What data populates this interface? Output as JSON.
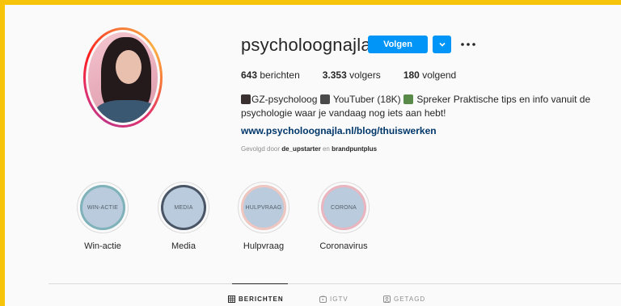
{
  "profile": {
    "username": "psycholoognajla",
    "follow_label": "Volgen"
  },
  "stats": {
    "posts_count": "643",
    "posts_label": "berichten",
    "followers_count": "3.353",
    "followers_label": "volgers",
    "following_count": "180",
    "following_label": "volgend"
  },
  "bio": {
    "line1_part1": "GZ-psycholoog",
    "line1_part2": "YouTuber (18K)",
    "line1_part3": "Spreker Praktische tips en info vanuit de",
    "line2": "psychologie waar je vandaag nog iets aan hebt!",
    "link": "www.psycholoognajla.nl/blog/thuiswerken"
  },
  "followed_by": {
    "prefix": "Gevolgd door",
    "user1": "de_upstarter",
    "joiner": "en",
    "user2": "brandpuntplus"
  },
  "highlights": [
    {
      "cover_text": "WIN-ACTIE",
      "label": "Win-actie",
      "ring_color": "#7fb3b9"
    },
    {
      "cover_text": "MEDIA",
      "label": "Media",
      "ring_color": "#4a5566"
    },
    {
      "cover_text": "HULPVRAAG",
      "label": "Hulpvraag",
      "ring_color": "#f0c6c0"
    },
    {
      "cover_text": "CORONA",
      "label": "Coronavirus",
      "ring_color": "#eab5be"
    }
  ],
  "tabs": [
    {
      "label": "BERICHTEN",
      "icon": "grid-icon"
    },
    {
      "label": "IGTV",
      "icon": "igtv-icon"
    },
    {
      "label": "GETAGD",
      "icon": "tagged-icon"
    }
  ],
  "colors": {
    "frame_border": "#f8c40a",
    "primary_button": "#0095f6",
    "link": "#00376b"
  }
}
